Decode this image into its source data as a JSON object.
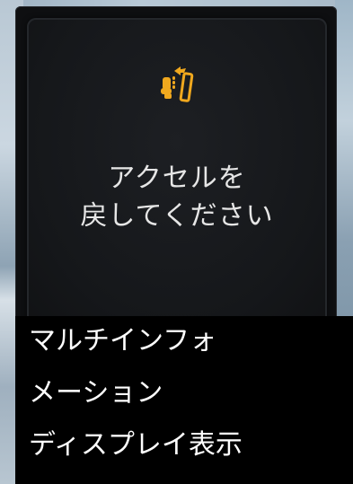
{
  "display": {
    "warning_icon": "accelerator-pedal-release-icon",
    "accent_color": "#f0a81e",
    "message_line1": "アクセルを",
    "message_line2": "戻してください"
  },
  "caption": {
    "line1": "マルチインフォ",
    "line2": "メーション",
    "line3": "ディスプレイ表示"
  }
}
